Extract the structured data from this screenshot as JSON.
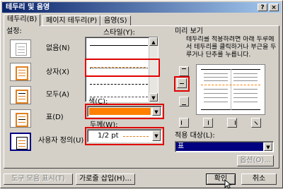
{
  "window": {
    "title": "테두리 및 음영",
    "help_glyph": "?",
    "close_glyph": "×"
  },
  "tabs": [
    {
      "label": "테두리(B)",
      "active": true
    },
    {
      "label": "페이지 테두리(P)",
      "active": false
    },
    {
      "label": "음영(S)",
      "active": false
    }
  ],
  "settings": {
    "header": "설정:",
    "items": [
      {
        "label": "없음(N)",
        "selected": false
      },
      {
        "label": "상자(X)",
        "selected": false
      },
      {
        "label": "모두(A)",
        "selected": false
      },
      {
        "label": "표(D)",
        "selected": false
      },
      {
        "label": "사용자 정의(U)",
        "selected": true
      }
    ]
  },
  "style": {
    "header": "스타일(Y):",
    "lines": [
      "solid",
      "dotted",
      "dashed",
      "dash-dot"
    ]
  },
  "color": {
    "label": "색(C):",
    "value": "#ff8000"
  },
  "width": {
    "label": "두께(W):",
    "value": "1/2 pt"
  },
  "preview": {
    "header": "미리 보기",
    "instructions": "테두리를 적용하려면 아래 두루에서 테두리를 클릭하거나 부근을 두루거나 단추를 누릅니다."
  },
  "apply_to": {
    "label": "적용 대상(L):",
    "value": "표"
  },
  "buttons": {
    "options": "옵션(O)...",
    "toolbar": "도구 모음 표시(T)",
    "horizontal_line": "가로줄 삽입(H)...",
    "ok": "확인",
    "cancel": "취소"
  },
  "colors": {
    "titlebar": "#0a246a",
    "highlight": "#e00000",
    "border_accent": "#ff8000",
    "selection": "#000080"
  }
}
